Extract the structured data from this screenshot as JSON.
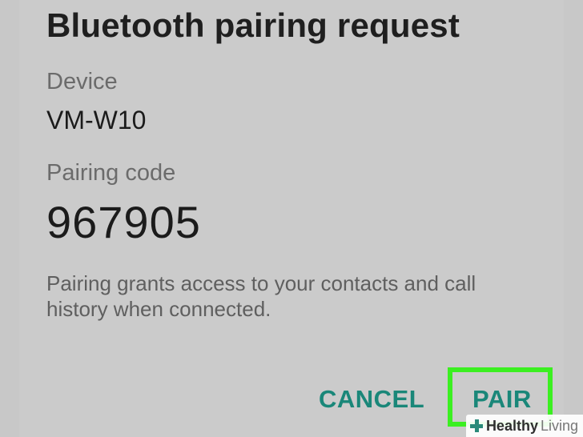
{
  "dialog": {
    "title": "Bluetooth pairing request",
    "device_label": "Device",
    "device_value": "VM-W10",
    "pairing_code_label": "Pairing code",
    "pairing_code_value": "967905",
    "description": "Pairing grants access to your contacts and call history when connected."
  },
  "actions": {
    "cancel_label": "CANCEL",
    "pair_label": "PAIR"
  },
  "watermark": {
    "brand_strong": "Healthy",
    "brand_light": "Living",
    "icon": "plus-icon"
  },
  "colors": {
    "dialog_bg": "#cbcbcb",
    "accent": "#1a8779",
    "highlight": "#3bef21"
  }
}
